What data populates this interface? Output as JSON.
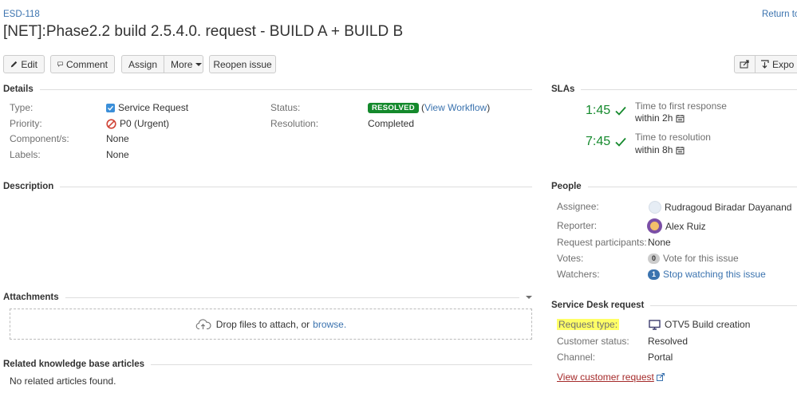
{
  "header": {
    "issue_key": "ESD-118",
    "return_link": "Return to",
    "summary": "[NET]:Phase2.2 build 2.5.4.0. request - BUILD A + BUILD B"
  },
  "toolbar": {
    "edit": "Edit",
    "comment": "Comment",
    "assign": "Assign",
    "more": "More",
    "reopen": "Reopen issue",
    "export": "Expo"
  },
  "details": {
    "heading": "Details",
    "type_label": "Type:",
    "type_value": "Service Request",
    "priority_label": "Priority:",
    "priority_value": "P0 (Urgent)",
    "components_label": "Component/s:",
    "components_value": "None",
    "labels_label": "Labels:",
    "labels_value": "None",
    "status_label": "Status:",
    "status_badge": "RESOLVED",
    "view_workflow_open": "(",
    "view_workflow": "View Workflow",
    "view_workflow_close": ")",
    "resolution_label": "Resolution:",
    "resolution_value": "Completed"
  },
  "description": {
    "heading": "Description"
  },
  "attachments": {
    "heading": "Attachments",
    "drop_text": "Drop files to attach, or",
    "browse": "browse."
  },
  "related": {
    "heading": "Related knowledge base articles",
    "empty": "No related articles found."
  },
  "slas": {
    "heading": "SLAs",
    "items": [
      {
        "time": "1:45",
        "desc": "Time to first response",
        "within": "within 2h"
      },
      {
        "time": "7:45",
        "desc": "Time to resolution",
        "within": "within 8h"
      }
    ]
  },
  "people": {
    "heading": "People",
    "assignee_label": "Assignee:",
    "assignee_value": "Rudragoud Biradar Dayanand",
    "reporter_label": "Reporter:",
    "reporter_value": "Alex Ruiz",
    "participants_label": "Request participants:",
    "participants_value": "None",
    "votes_label": "Votes:",
    "votes_count": "0",
    "votes_link": "Vote for this issue",
    "watchers_label": "Watchers:",
    "watchers_count": "1",
    "watchers_link": "Stop watching this issue"
  },
  "service_desk": {
    "heading": "Service Desk request",
    "request_type_label": "Request type:",
    "request_type_value": "OTV5 Build creation",
    "customer_status_label": "Customer status:",
    "customer_status_value": "Resolved",
    "channel_label": "Channel:",
    "channel_value": "Portal",
    "view_customer_request": "View customer request"
  },
  "colors": {
    "link": "#3b73af",
    "success": "#14892c",
    "highlight": "#ffff66"
  }
}
